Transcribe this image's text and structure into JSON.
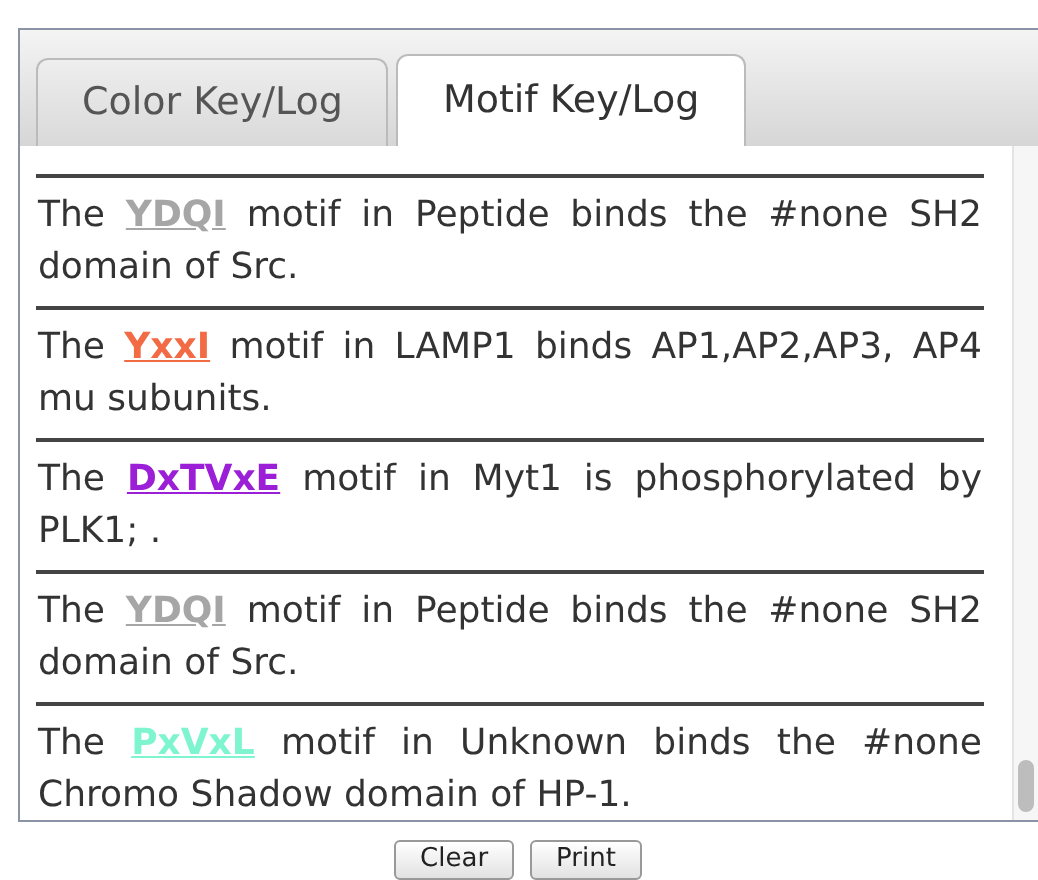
{
  "tabs": [
    {
      "label": "Color Key/Log",
      "selected": false
    },
    {
      "label": "Motif Key/Log",
      "selected": true
    }
  ],
  "log_entries": [
    {
      "before": "The",
      "motif": "YDQI",
      "color": "#a6a6a6",
      "after": "motif in Peptide binds the #none SH2 domain of Src."
    },
    {
      "before": "The",
      "motif": "YxxI",
      "color": "#f26b45",
      "after": "motif in LAMP1 binds AP1,AP2,AP3, AP4 mu subunits."
    },
    {
      "before": "The",
      "motif": "DxTVxE",
      "color": "#9b1fd6",
      "after": "motif in Myt1 is phosphorylated by PLK1; ."
    },
    {
      "before": "The",
      "motif": "YDQI",
      "color": "#a6a6a6",
      "after": "motif in Peptide binds the #none SH2 domain of Src."
    },
    {
      "before": "The",
      "motif": "PxVxL",
      "color": "#7ff5cf",
      "after": "motif in Unknown binds the #none Chromo Shadow domain of HP-1."
    }
  ],
  "buttons": [
    "Clear",
    "Print"
  ]
}
